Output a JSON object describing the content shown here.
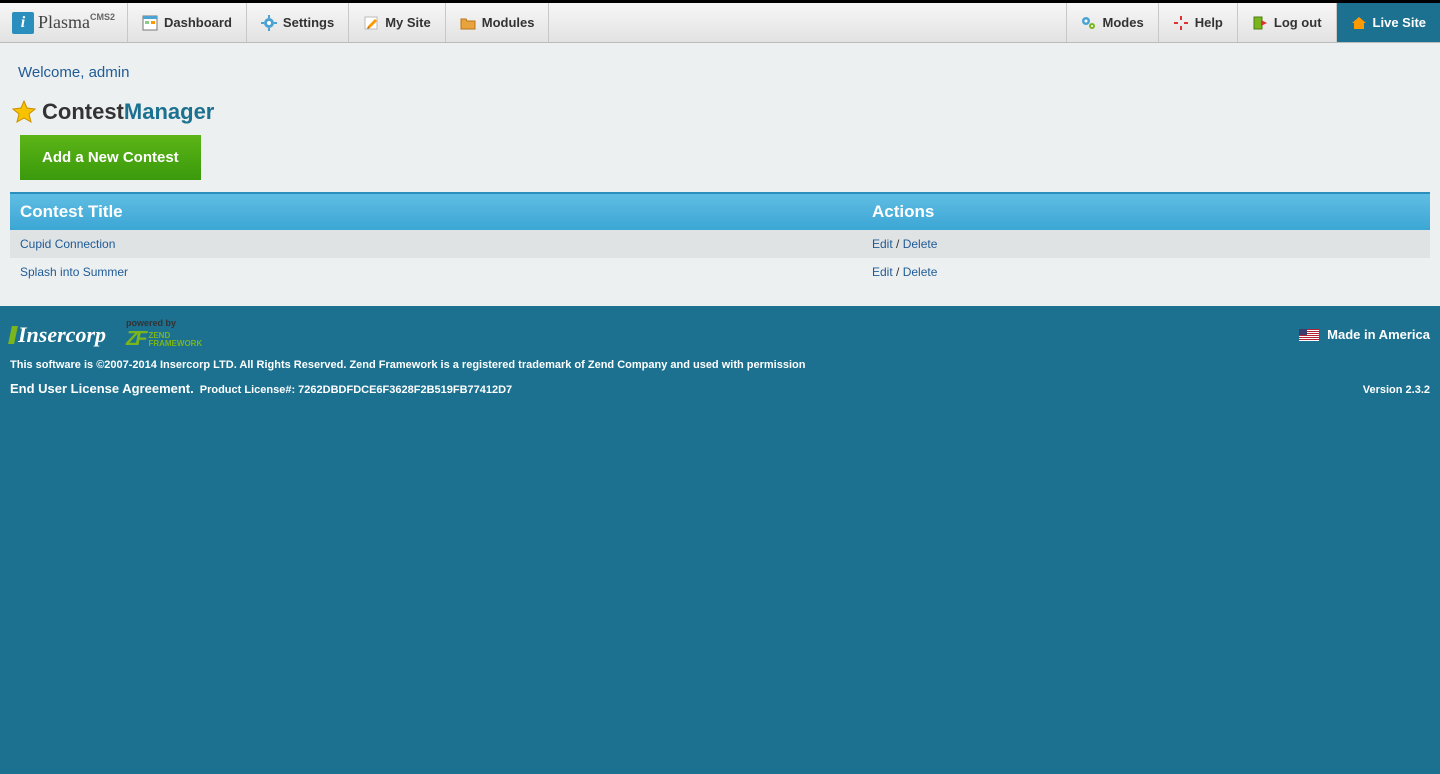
{
  "brand": {
    "name": "Plasma",
    "suffix": "CMS2"
  },
  "nav": {
    "left": [
      {
        "label": "Dashboard",
        "icon": "dashboard-icon"
      },
      {
        "label": "Settings",
        "icon": "gear-icon"
      },
      {
        "label": "My Site",
        "icon": "pencil-icon"
      },
      {
        "label": "Modules",
        "icon": "folder-icon"
      }
    ],
    "right": [
      {
        "label": "Modes",
        "icon": "gears-icon"
      },
      {
        "label": "Help",
        "icon": "help-icon"
      },
      {
        "label": "Log out",
        "icon": "logout-icon"
      },
      {
        "label": "Live Site",
        "icon": "home-icon",
        "highlight": true
      }
    ]
  },
  "welcome": "Welcome, admin",
  "page_title": {
    "part1": "Contest",
    "part2": "Manager"
  },
  "add_button": "Add a New Contest",
  "table": {
    "columns": [
      "Contest Title",
      "Actions"
    ],
    "rows": [
      {
        "title": "Cupid Connection",
        "actions": {
          "edit": "Edit",
          "sep": "/",
          "delete": "Delete"
        }
      },
      {
        "title": "Splash into Summer",
        "actions": {
          "edit": "Edit",
          "sep": "/",
          "delete": "Delete"
        }
      }
    ]
  },
  "footer": {
    "company": "Insercorp",
    "powered_by_label": "powered by",
    "zend_line1": "ZEND",
    "zend_line2": "FRAMEWORK",
    "made_in": "Made in America",
    "copyright": "This software is ©2007-2014 Insercorp LTD. All Rights Reserved. Zend Framework is a registered trademark of Zend Company and used with permission",
    "eula": "End User License Agreement.",
    "license_label": "Product License#: ",
    "license_value": "7262DBDFDCE6F3628F2B519FB77412D7",
    "version": "Version 2.3.2"
  }
}
